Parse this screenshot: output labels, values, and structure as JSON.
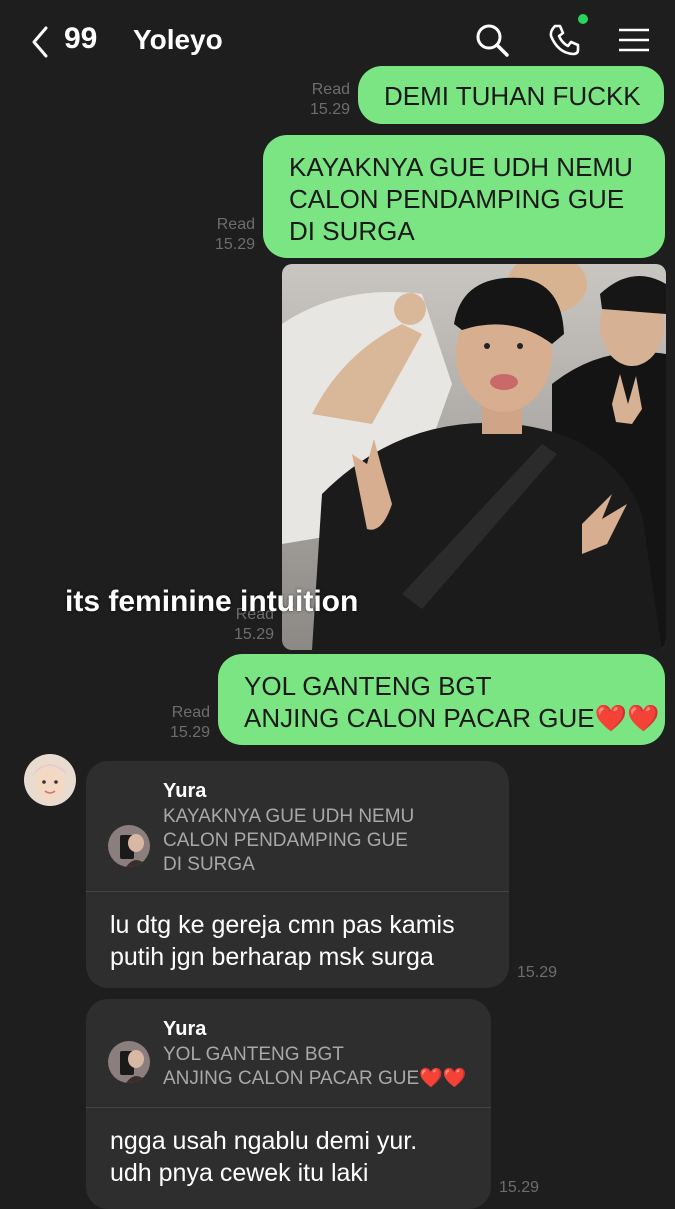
{
  "header": {
    "unread_count": "99",
    "title": "Yoleyo",
    "icons": [
      "back-chevron-icon",
      "search-icon",
      "phone-icon",
      "menu-icon"
    ],
    "colors": {
      "online_dot": "#2ad35a"
    }
  },
  "messages": {
    "m1": {
      "text": "DEMI TUHAN FUCKK",
      "read": "Read",
      "time": "15.29"
    },
    "m2": {
      "lines": [
        "KAYAKNYA GUE UDH NEMU",
        "CALON PENDAMPING GUE",
        "DI SURGA"
      ],
      "read": "Read",
      "time": "15.29"
    },
    "m3": {
      "read": "Read",
      "time": "15.29",
      "caption": "its feminine intuition"
    },
    "m4": {
      "lines": [
        "YOL GANTENG BGT",
        "ANJING CALON PACAR GUE❤️❤️"
      ],
      "read": "Read",
      "time": "15.29"
    },
    "r1": {
      "name": "Yura",
      "quote": [
        "KAYAKNYA GUE UDH NEMU",
        "CALON PENDAMPING GUE",
        "DI SURGA"
      ],
      "text": [
        "lu dtg ke gereja cmn pas kamis",
        "putih jgn berharap msk surga"
      ],
      "time": "15.29"
    },
    "r2": {
      "name": "Yura",
      "quote": [
        "YOL GANTENG BGT",
        "ANJING CALON PACAR GUE❤️❤️"
      ],
      "text": [
        "ngga usah ngablu demi yur.",
        "udh pnya cewek itu laki"
      ],
      "time": "15.29"
    }
  },
  "colors": {
    "outgoing_bubble": "#7ae582",
    "incoming_bubble": "#2e2e2e",
    "background": "#1e1e1e"
  }
}
